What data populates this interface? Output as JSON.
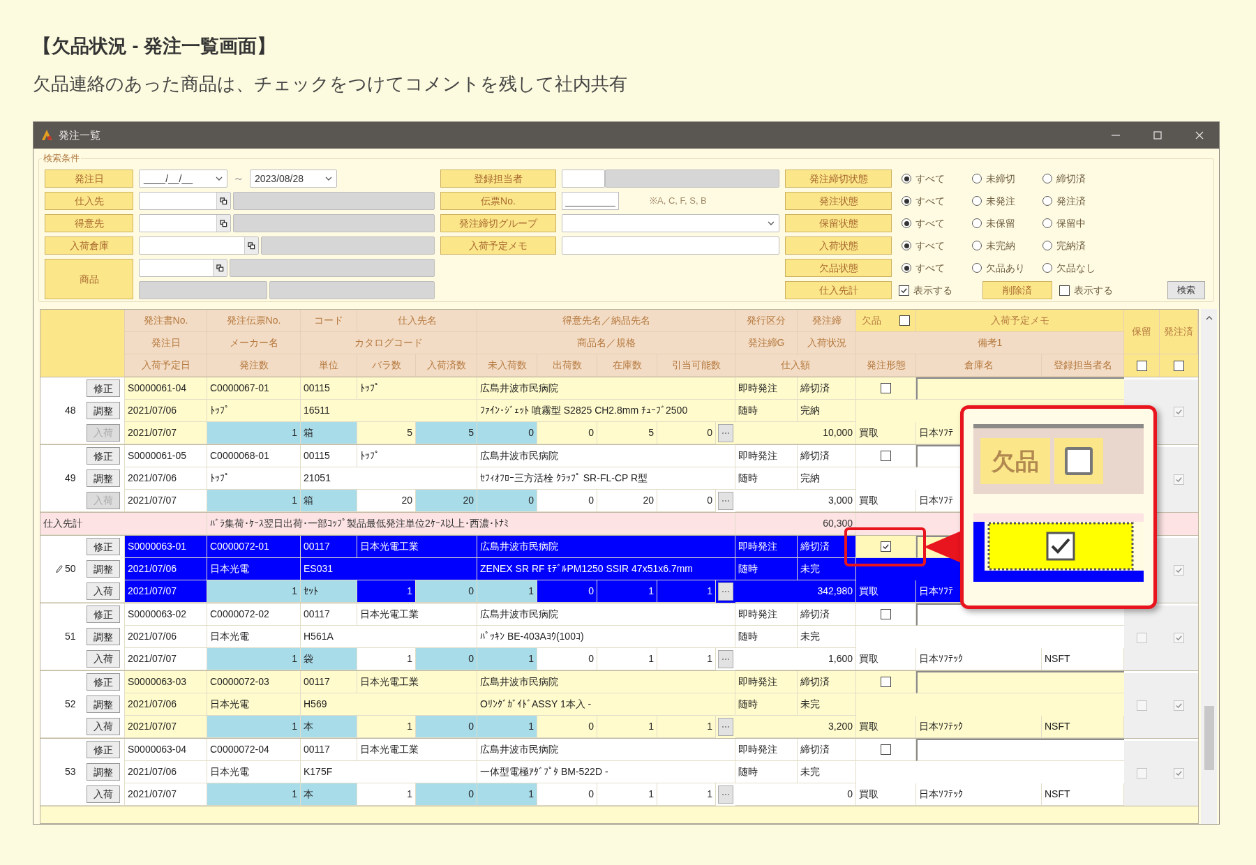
{
  "heading": "【欠品状況 - 発注一覧画面】",
  "subheading": "欠品連絡のあった商品は、チェックをつけてコメントを残して社内共有",
  "window": {
    "title": "発注一覧"
  },
  "search": {
    "legend": "検索条件",
    "left_fields": [
      {
        "label": "発注日",
        "kind": "date_range",
        "from": "____/__/__",
        "separator": "～",
        "to": "2023/08/28"
      },
      {
        "label": "仕入先",
        "kind": "lookup"
      },
      {
        "label": "得意先",
        "kind": "lookup"
      },
      {
        "label": "入荷倉庫",
        "kind": "lookup_wide"
      },
      {
        "label": "商品",
        "kind": "lookup_double"
      }
    ],
    "middle_fields": [
      {
        "label": "登録担当者",
        "kind": "person"
      },
      {
        "label": "伝票No.",
        "kind": "slip",
        "note": "※A, C, F, S, B"
      },
      {
        "label": "発注締切グループ",
        "kind": "dropdown"
      },
      {
        "label": "入荷予定メモ",
        "kind": "text"
      }
    ],
    "status_filters": [
      {
        "label": "発注締切状態",
        "options": [
          {
            "label": "すべて",
            "selected": true
          },
          {
            "label": "未締切",
            "selected": false
          },
          {
            "label": "締切済",
            "selected": false
          }
        ]
      },
      {
        "label": "発注状態",
        "options": [
          {
            "label": "すべて",
            "selected": true
          },
          {
            "label": "未発注",
            "selected": false
          },
          {
            "label": "発注済",
            "selected": false
          }
        ]
      },
      {
        "label": "保留状態",
        "options": [
          {
            "label": "すべて",
            "selected": true
          },
          {
            "label": "未保留",
            "selected": false
          },
          {
            "label": "保留中",
            "selected": false
          }
        ]
      },
      {
        "label": "入荷状態",
        "options": [
          {
            "label": "すべて",
            "selected": true
          },
          {
            "label": "未完納",
            "selected": false
          },
          {
            "label": "完納済",
            "selected": false
          }
        ]
      },
      {
        "label": "欠品状態",
        "options": [
          {
            "label": "すべて",
            "selected": true
          },
          {
            "label": "欠品あり",
            "selected": false
          },
          {
            "label": "欠品なし",
            "selected": false
          }
        ]
      }
    ],
    "totals": {
      "label": "仕入先計",
      "option_label": "表示する",
      "checked": true
    },
    "deleted": {
      "label": "削除済",
      "option_label": "表示する",
      "checked": false
    },
    "search_button": "検索"
  },
  "table": {
    "header": {
      "row1": [
        "発注書No.",
        "発注伝票No.",
        "コード",
        "仕入先名",
        "得意先名／納品先名",
        "発行区分",
        "発注締",
        "欠品",
        "入荷予定メモ",
        "保留",
        "発注済"
      ],
      "row2": [
        "発注日",
        "メーカー名",
        "カタログコード",
        "商品名／規格",
        "発注締G",
        "入荷状況",
        "備考1"
      ],
      "row3": [
        "入荷予定日",
        "発注数",
        "単位",
        "バラ数",
        "入荷済数",
        "未入荷数",
        "出荷数",
        "在庫数",
        "引当可能数",
        "仕入額",
        "発注形態",
        "倉庫名",
        "登録担当者名"
      ],
      "defect_all_checked": false,
      "hold_all_checked": false,
      "ordered_all_checked": false
    },
    "rows": [
      {
        "kind": "order",
        "no": "48",
        "editing": false,
        "selected": false,
        "striped": true,
        "buttons": [
          "修正",
          "調整",
          "入荷"
        ],
        "receive_disabled": true,
        "order_no": "S0000061-04",
        "slip_no": "C0000067-01",
        "code": "00115",
        "supplier": "ﾄｯﾌﾟ",
        "customer": "広島井波市民病院",
        "issue_type": "即時発注",
        "close_state": "締切済",
        "defect": false,
        "order_date": "2021/07/06",
        "maker": "ﾄｯﾌﾟ",
        "catalog_code": "16511",
        "product": "ﾌｧｲﾝ･ｼﾞｪｯﾄ 噴霧型 S2825 CH2.8mm ﾁｭｰﾌﾞ2500",
        "timing": "随時",
        "arrival_state": "完納",
        "arrival_date": "2021/07/07",
        "qty": "1",
        "unit": "箱",
        "loose": "5",
        "received": "5",
        "unreceived": "0",
        "shipped": "0",
        "stock": "5",
        "allocatable": "0",
        "amount": "10,000",
        "order_type": "買取",
        "warehouse": "日本ｿﾌﾃ",
        "ordered": true
      },
      {
        "kind": "order",
        "no": "49",
        "editing": false,
        "selected": false,
        "striped": false,
        "buttons": [
          "修正",
          "調整",
          "入荷"
        ],
        "receive_disabled": true,
        "order_no": "S0000061-05",
        "slip_no": "C0000068-01",
        "code": "00115",
        "supplier": "ﾄｯﾌﾟ",
        "customer": "広島井波市民病院",
        "issue_type": "即時発注",
        "close_state": "締切済",
        "defect": false,
        "order_date": "2021/07/06",
        "maker": "ﾄｯﾌﾟ",
        "catalog_code": "21051",
        "product": "ｾﾌｨｵﾌﾛｰ三方活栓 ｸﾗｯﾌﾟ SR-FL-CP R型",
        "timing": "随時",
        "arrival_state": "完納",
        "arrival_date": "2021/07/07",
        "qty": "1",
        "unit": "箱",
        "loose": "20",
        "received": "20",
        "unreceived": "0",
        "shipped": "0",
        "stock": "20",
        "allocatable": "0",
        "amount": "3,000",
        "order_type": "買取",
        "warehouse": "日本ｿﾌﾃ",
        "ordered": true
      },
      {
        "kind": "subtotal",
        "label": "仕入先計",
        "note": "ﾊﾞﾗ集荷･ｹｰｽ翌日出荷･一部ｺｯﾌﾟ製品最低発注単位2ｹｰｽ以上･西濃･ﾄﾅﾐ",
        "amount": "60,300"
      },
      {
        "kind": "order",
        "no": "50",
        "editing": true,
        "selected": true,
        "striped": true,
        "buttons": [
          "修正",
          "調整",
          "入荷"
        ],
        "receive_disabled": false,
        "order_no": "S0000063-01",
        "slip_no": "C0000072-01",
        "code": "00117",
        "supplier": "日本光電工業",
        "customer": "広島井波市民病院",
        "issue_type": "即時発注",
        "close_state": "締切済",
        "defect": true,
        "order_date": "2021/07/06",
        "maker": "日本光電",
        "catalog_code": "ES031",
        "product": "ZENEX SR RF ﾓﾃﾞﾙPM1250 SSIR 47x51x6.7mm",
        "timing": "随時",
        "arrival_state": "未完",
        "arrival_date": "2021/07/07",
        "qty": "1",
        "unit": "ｾｯﾄ",
        "loose": "1",
        "received": "0",
        "unreceived": "1",
        "shipped": "0",
        "stock": "1",
        "allocatable": "1",
        "amount": "342,980",
        "order_type": "買取",
        "warehouse": "日本ｿﾌﾃ",
        "ordered": true
      },
      {
        "kind": "order",
        "no": "51",
        "editing": false,
        "selected": false,
        "striped": false,
        "buttons": [
          "修正",
          "調整",
          "入荷"
        ],
        "receive_disabled": false,
        "order_no": "S0000063-02",
        "slip_no": "C0000072-02",
        "code": "00117",
        "supplier": "日本光電工業",
        "customer": "広島井波市民病院",
        "issue_type": "即時発注",
        "close_state": "締切済",
        "defect": false,
        "order_date": "2021/07/06",
        "maker": "日本光電",
        "catalog_code": "H561A",
        "product": "ﾊﾟｯｷﾝ BE-403Aﾖｳ(100ｺ)",
        "timing": "随時",
        "arrival_state": "未完",
        "arrival_date": "2021/07/07",
        "qty": "1",
        "unit": "袋",
        "loose": "1",
        "received": "0",
        "unreceived": "1",
        "shipped": "0",
        "stock": "1",
        "allocatable": "1",
        "amount": "1,600",
        "order_type": "買取",
        "warehouse": "日本ｿﾌﾃｯｸ",
        "registrant": "NSFT",
        "hold": false,
        "ordered": true
      },
      {
        "kind": "order",
        "no": "52",
        "editing": false,
        "selected": false,
        "striped": true,
        "buttons": [
          "修正",
          "調整",
          "入荷"
        ],
        "receive_disabled": false,
        "order_no": "S0000063-03",
        "slip_no": "C0000072-03",
        "code": "00117",
        "supplier": "日本光電工業",
        "customer": "広島井波市民病院",
        "issue_type": "即時発注",
        "close_state": "締切済",
        "defect": false,
        "order_date": "2021/07/06",
        "maker": "日本光電",
        "catalog_code": "H569",
        "product": "OﾘﾝｸﾞｶﾞｲﾄﾞASSY 1本入 -",
        "timing": "随時",
        "arrival_state": "未完",
        "arrival_date": "2021/07/07",
        "qty": "1",
        "unit": "本",
        "loose": "1",
        "received": "0",
        "unreceived": "1",
        "shipped": "0",
        "stock": "1",
        "allocatable": "1",
        "amount": "3,200",
        "order_type": "買取",
        "warehouse": "日本ｿﾌﾃｯｸ",
        "registrant": "NSFT",
        "hold": false,
        "ordered": true
      },
      {
        "kind": "order",
        "no": "53",
        "editing": false,
        "selected": false,
        "striped": false,
        "buttons": [
          "修正",
          "調整",
          "入荷"
        ],
        "receive_disabled": false,
        "order_no": "S0000063-04",
        "slip_no": "C0000072-04",
        "code": "00117",
        "supplier": "日本光電工業",
        "customer": "広島井波市民病院",
        "issue_type": "即時発注",
        "close_state": "締切済",
        "defect": false,
        "order_date": "2021/07/06",
        "maker": "日本光電",
        "catalog_code": "K175F",
        "product": "一体型電極ｱﾀﾞﾌﾟﾀ BM-522D -",
        "timing": "随時",
        "arrival_state": "未完",
        "arrival_date": "2021/07/07",
        "qty": "1",
        "unit": "本",
        "loose": "1",
        "received": "0",
        "unreceived": "1",
        "shipped": "0",
        "stock": "1",
        "allocatable": "1",
        "amount": "0",
        "order_type": "買取",
        "warehouse": "日本ｿﾌﾃｯｸ",
        "registrant": "NSFT",
        "hold": false,
        "ordered": true
      },
      {
        "kind": "partial",
        "striped": true
      }
    ]
  },
  "callout": {
    "header_label": "欠品",
    "header_checked": false,
    "cell_checked": true
  }
}
